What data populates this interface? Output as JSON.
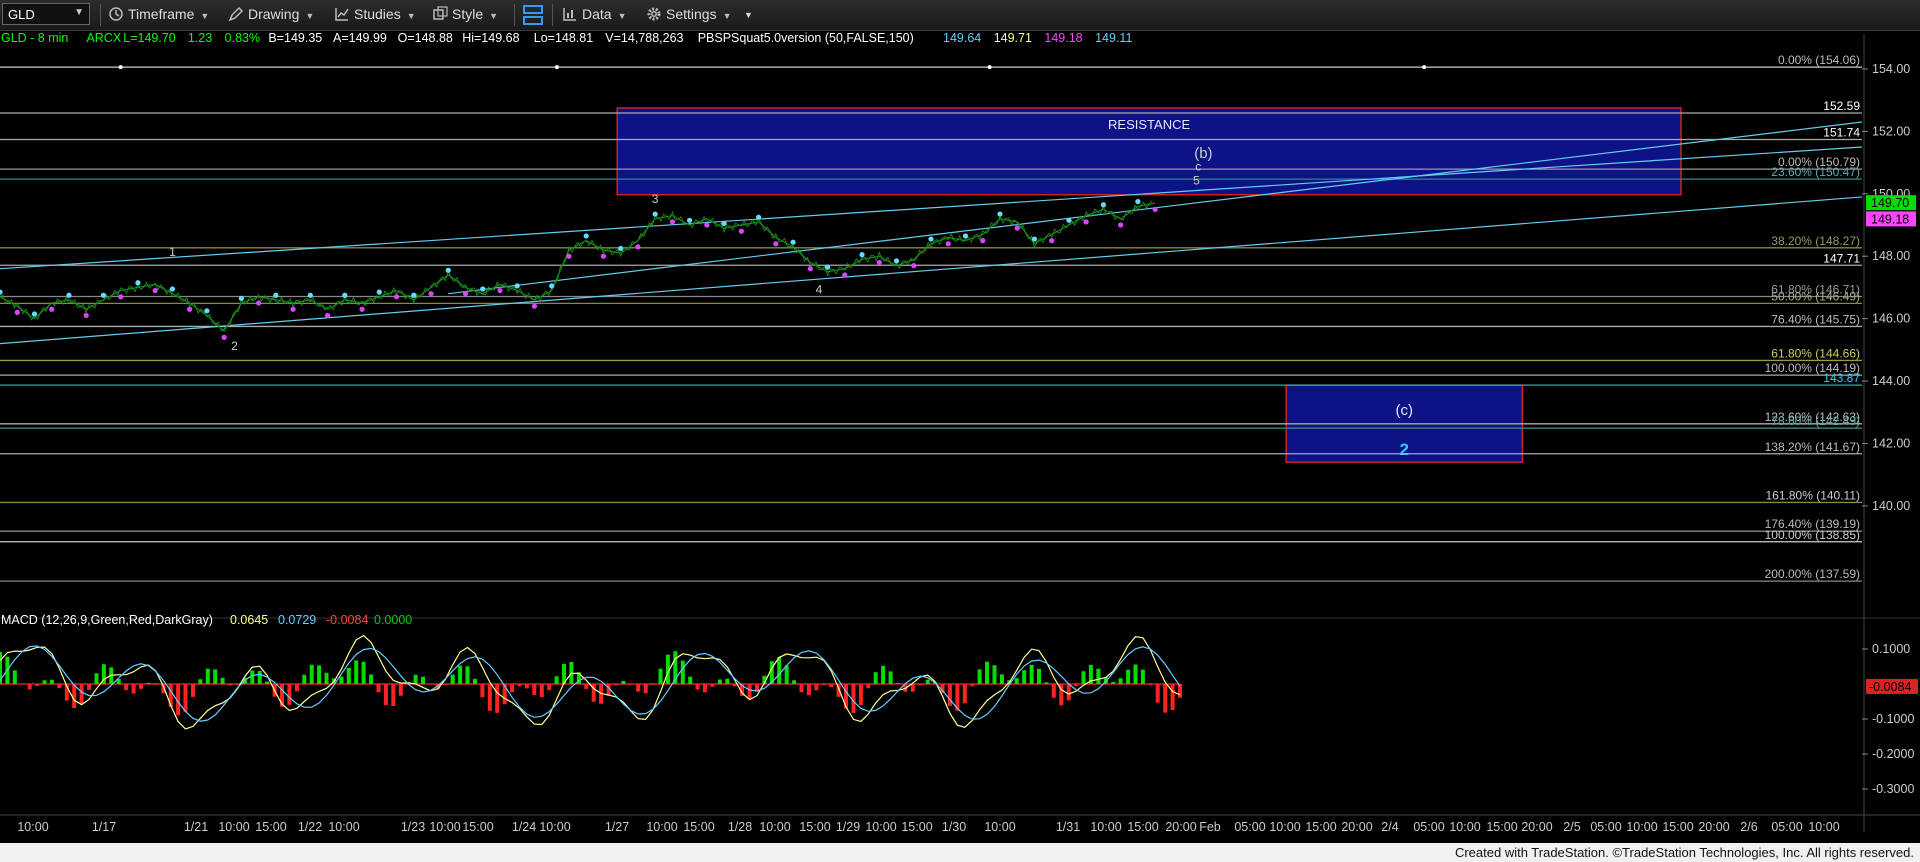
{
  "toolbar": {
    "symbol": "GLD",
    "items": [
      {
        "label": "Timeframe",
        "icon": "clock-icon"
      },
      {
        "label": "Drawing",
        "icon": "pencil-icon"
      },
      {
        "label": "Studies",
        "icon": "studies-icon"
      },
      {
        "label": "Style",
        "icon": "style-icon"
      },
      {
        "label": "",
        "icon": "layout-icon"
      },
      {
        "label": "Data",
        "icon": "data-icon"
      },
      {
        "label": "Settings",
        "icon": "gear-icon"
      }
    ]
  },
  "legend": [
    {
      "text": "GLD - 8 min",
      "color": "#00ff00"
    },
    {
      "text": "ARCX",
      "color": "#00ff00"
    },
    {
      "text": "L=149.70",
      "color": "#00ff00"
    },
    {
      "text": "1.23",
      "color": "#00ff00"
    },
    {
      "text": "0.83%",
      "color": "#00ff00"
    },
    {
      "text": "B=149.35",
      "color": "#ffffff"
    },
    {
      "text": "A=149.99",
      "color": "#ffffff"
    },
    {
      "text": "O=148.88",
      "color": "#ffffff"
    },
    {
      "text": "Hi=149.68",
      "color": "#ffffff"
    },
    {
      "text": "Lo=148.81",
      "color": "#ffffff"
    },
    {
      "text": "V=14,788,263",
      "color": "#ffffff"
    },
    {
      "text": "PBSPSquat5.0version (50,FALSE,150)",
      "color": "#ffffff"
    },
    {
      "text": "149.64",
      "color": "#66ccff"
    },
    {
      "text": "149.71",
      "color": "#ffff99"
    },
    {
      "text": "149.18",
      "color": "#ff44ff"
    },
    {
      "text": "149.11",
      "color": "#66ccff"
    }
  ],
  "chart_data": [
    {
      "type": "candlestick",
      "symbol": "GLD",
      "interval": "8 min",
      "ylim": [
        136.6,
        154.8
      ],
      "yticks": [
        154,
        152,
        150,
        148,
        146,
        144,
        142,
        140
      ],
      "x_labels": [
        "10:00",
        "1/17",
        "1/21",
        "10:00",
        "15:00",
        "1/22",
        "10:00",
        "1/23",
        "10:00",
        "15:00",
        "1/24",
        "10:00",
        "1/27",
        "10:00",
        "15:00",
        "1/28",
        "10:00",
        "15:00",
        "1/29",
        "10:00",
        "15:00",
        "1/30",
        "10:00",
        "1/31",
        "10:00",
        "15:00",
        "20:00",
        "Feb",
        "05:00",
        "10:00",
        "15:00",
        "20:00",
        "2/4",
        "05:00",
        "10:00",
        "15:00",
        "20:00",
        "2/5",
        "05:00",
        "10:00",
        "15:00",
        "20:00",
        "2/6",
        "05:00",
        "10:00"
      ],
      "price_path": [
        [
          0,
          146.7
        ],
        [
          1,
          146.4
        ],
        [
          2,
          146.0
        ],
        [
          3,
          146.5
        ],
        [
          4,
          146.6
        ],
        [
          5,
          146.3
        ],
        [
          6,
          146.6
        ],
        [
          7,
          146.9
        ],
        [
          8,
          147.0
        ],
        [
          9,
          147.1
        ],
        [
          10,
          146.8
        ],
        [
          11,
          146.5
        ],
        [
          12,
          146.1
        ],
        [
          13,
          145.6
        ],
        [
          14,
          146.5
        ],
        [
          15,
          146.7
        ],
        [
          16,
          146.6
        ],
        [
          17,
          146.5
        ],
        [
          18,
          146.6
        ],
        [
          19,
          146.3
        ],
        [
          20,
          146.6
        ],
        [
          21,
          146.5
        ],
        [
          22,
          146.7
        ],
        [
          23,
          146.9
        ],
        [
          24,
          146.6
        ],
        [
          25,
          147.0
        ],
        [
          26,
          147.4
        ],
        [
          27,
          147.0
        ],
        [
          28,
          146.8
        ],
        [
          29,
          147.1
        ],
        [
          30,
          146.9
        ],
        [
          31,
          146.6
        ],
        [
          32,
          146.9
        ],
        [
          33,
          148.2
        ],
        [
          34,
          148.5
        ],
        [
          35,
          148.2
        ],
        [
          36,
          148.1
        ],
        [
          37,
          148.5
        ],
        [
          38,
          149.2
        ],
        [
          39,
          149.3
        ],
        [
          40,
          149.0
        ],
        [
          41,
          149.2
        ],
        [
          42,
          148.9
        ],
        [
          43,
          149.0
        ],
        [
          44,
          149.1
        ],
        [
          45,
          148.6
        ],
        [
          46,
          148.3
        ],
        [
          47,
          147.8
        ],
        [
          48,
          147.5
        ],
        [
          49,
          147.6
        ],
        [
          50,
          147.9
        ],
        [
          51,
          148.0
        ],
        [
          52,
          147.7
        ],
        [
          53,
          147.9
        ],
        [
          54,
          148.4
        ],
        [
          55,
          148.6
        ],
        [
          56,
          148.5
        ],
        [
          57,
          148.7
        ],
        [
          58,
          149.2
        ],
        [
          59,
          149.1
        ],
        [
          60,
          148.4
        ],
        [
          61,
          148.7
        ],
        [
          62,
          149.0
        ],
        [
          63,
          149.3
        ],
        [
          64,
          149.5
        ],
        [
          65,
          149.2
        ],
        [
          66,
          149.6
        ],
        [
          67,
          149.7
        ]
      ],
      "horizontal_levels": [
        {
          "price": 154.06,
          "label": "0.00% (154.06)",
          "color": "#cccccc",
          "label_color": "#bbbbbb"
        },
        {
          "price": 152.59,
          "label": "152.59",
          "color": "#aaaaaa",
          "label_color": "#ffffff"
        },
        {
          "price": 151.74,
          "label": "151.74",
          "color": "#aaaaaa",
          "label_color": "#ffffff"
        },
        {
          "price": 150.79,
          "label": "0.00% (150.79)",
          "color": "#999999",
          "label_color": "#bbbbbb"
        },
        {
          "price": 150.47,
          "label": "23.60% (150.47)",
          "color": "#338888",
          "label_color": "#66aaaa"
        },
        {
          "price": 148.27,
          "label": "38.20% (148.27)",
          "color": "#888844",
          "label_color": "#999966"
        },
        {
          "price": 147.71,
          "label": "147.71",
          "color": "#aaaaaa",
          "label_color": "#ffffff"
        },
        {
          "price": 146.71,
          "label": "61.80% (146.71)",
          "color": "#888888",
          "label_color": "#999999"
        },
        {
          "price": 146.49,
          "label": "50.00% (146.49)",
          "color": "#888844",
          "label_color": "#aaaa88"
        },
        {
          "price": 145.75,
          "label": "76.40% (145.75)",
          "color": "#aaaaaa",
          "label_color": "#bbbbbb"
        },
        {
          "price": 144.66,
          "label": "61.80% (144.66)",
          "color": "#999944",
          "label_color": "#cccc66"
        },
        {
          "price": 144.19,
          "label": "100.00% (144.19)",
          "color": "#aaaaaa",
          "label_color": "#bbbbbb"
        },
        {
          "price": 143.87,
          "label": "143.87",
          "color": "#33aaaa",
          "label_color": "#33ccff"
        },
        {
          "price": 142.63,
          "label": "123.60% (142.63)",
          "color": "#aaaaaa",
          "label_color": "#bbbbbb"
        },
        {
          "price": 142.49,
          "label": "78.60% (142.49)",
          "color": "#338888",
          "label_color": "#66aaaa"
        },
        {
          "price": 141.67,
          "label": "138.20% (141.67)",
          "color": "#aaaaaa",
          "label_color": "#bbbbbb"
        },
        {
          "price": 140.11,
          "label": "161.80% (140.11)",
          "color": "#888844",
          "label_color": "#cccccc"
        },
        {
          "price": 139.19,
          "label": "176.40% (139.19)",
          "color": "#888888",
          "label_color": "#bbbbbb"
        },
        {
          "price": 138.85,
          "label": "100.00% (138.85)",
          "color": "#cccccc",
          "label_color": "#cccccc"
        },
        {
          "price": 137.59,
          "label": "200.00% (137.59)",
          "color": "#888888",
          "label_color": "#bbbbbb"
        }
      ],
      "last_price_tags": [
        {
          "price": 149.7,
          "label": "149.70",
          "background": "#00dd00",
          "color": "#000000"
        },
        {
          "price": 149.18,
          "label": "149.18",
          "background": "#ff44ff",
          "color": "#000000"
        }
      ],
      "zones": [
        {
          "name": "resistance",
          "label": "RESISTANCE",
          "price_top": 152.75,
          "price_bottom": 149.97,
          "x_start": 35.8,
          "x_end": 97.5
        },
        {
          "name": "target-c-2",
          "label": "(c)",
          "sublabel": "2",
          "price_top": 143.87,
          "price_bottom": 141.4,
          "x_start": 74.6,
          "x_end": 88.3
        }
      ],
      "trend_lines": [
        {
          "from": [
            0,
            147.6
          ],
          "to": [
            108,
            151.5
          ],
          "color": "#66ccee"
        },
        {
          "from": [
            0,
            145.2
          ],
          "to": [
            108,
            149.9
          ],
          "color": "#66ccee"
        },
        {
          "from": [
            26,
            146.8
          ],
          "to": [
            108,
            152.3
          ],
          "color": "#66ccee"
        }
      ],
      "wave_labels": [
        {
          "text": "1",
          "x": 10,
          "price": 148.0
        },
        {
          "text": "2",
          "x": 13.6,
          "price": 145.0
        },
        {
          "text": "3",
          "x": 38,
          "price": 149.7
        },
        {
          "text": "4",
          "x": 47.5,
          "price": 146.8
        },
        {
          "text": "5",
          "x": 69.4,
          "price": 150.3
        },
        {
          "text": "c",
          "x": 69.5,
          "price": 150.75
        },
        {
          "text": "(b)",
          "x": 69.8,
          "price": 151.15
        }
      ],
      "markers_on_top_line": [
        7,
        32.3,
        57.4,
        82.6
      ]
    },
    {
      "type": "macd",
      "title": "MACD (12,26,9,Green,Red,DarkGray)",
      "values": {
        "macd": 0.0645,
        "signal": 0.0729,
        "diff": -0.0084,
        "zero": 0.0
      },
      "value_colors": [
        "#ffff99",
        "#66ccff",
        "#ff4444",
        "#00cc00"
      ],
      "ylim": [
        -0.36,
        0.16
      ],
      "yticks": [
        0.1,
        -0.1,
        -0.2,
        -0.3
      ],
      "last_diff_tag": "-0.0084"
    }
  ]
}
